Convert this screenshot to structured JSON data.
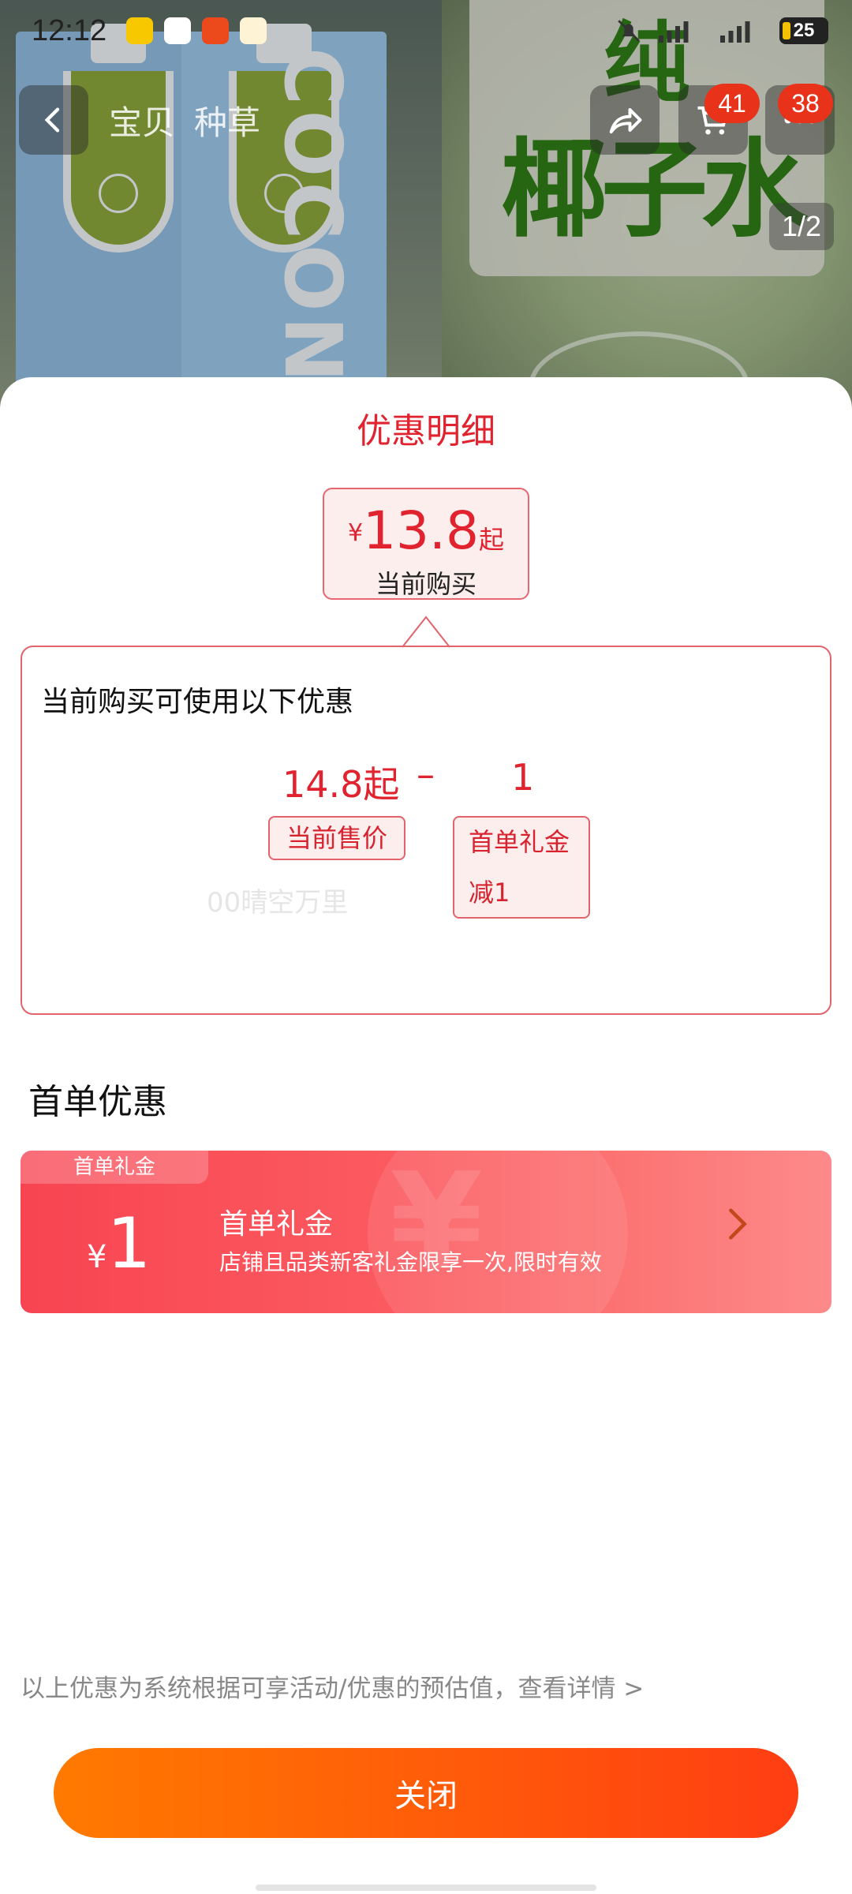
{
  "status_bar": {
    "time": "12:12",
    "battery": "25"
  },
  "nav": {
    "tabs": [
      "宝贝",
      "种草"
    ],
    "cart_badge": "41",
    "more_badge": "38"
  },
  "hero": {
    "banner_line1": "纯",
    "banner_line2": "椰子水",
    "carton_text": "COCON",
    "page_indicator": "1/2"
  },
  "sheet": {
    "title": "优惠明细",
    "price": {
      "currency": "¥",
      "amount": "13.8",
      "suffix": "起",
      "label": "当前购买"
    },
    "detail": {
      "heading": "当前购买可使用以下优惠",
      "current_price": "14.8起",
      "operator": "–",
      "discount_value": "1",
      "current_price_tag": "当前售价",
      "discount_tag_line1": "首单礼金",
      "discount_tag_line2": "减1",
      "watermark": "00晴空万里"
    },
    "section_title": "首单优惠",
    "coupon": {
      "corner_label": "首单礼金",
      "currency": "¥",
      "value": "1",
      "name": "首单礼金",
      "description": "店铺且品类新客礼金限享一次,限时有效"
    },
    "footnote": "以上优惠为系统根据可享活动/优惠的预估值，查看详情 >",
    "close_label": "关闭"
  },
  "colors": {
    "accent_red": "#e0232f",
    "coupon_red": "#f84452",
    "close_orange": "#ff5a0a"
  }
}
